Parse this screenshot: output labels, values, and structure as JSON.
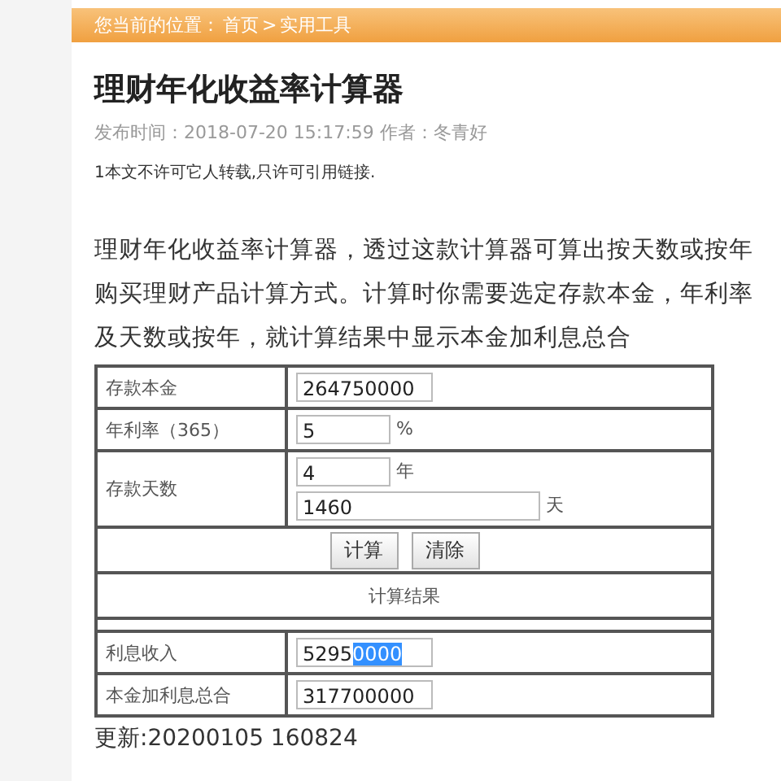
{
  "breadcrumb": {
    "label": "您当前的位置：",
    "links": [
      "首页",
      "实用工具"
    ],
    "separator": ">"
  },
  "article": {
    "title": "理财年化收益率计算器",
    "meta": "发布时间：2018-07-20 15:17:59 作者：冬青好",
    "notice": "1本文不许可它人转载,只许可引用链接.",
    "paragraph": "理财年化收益率计算器，透过这款计算器可算出按天数或按年购买理财产品计算方式。计算时你需要选定存款本金，年利率及天数或按年，就计算结果中显示本金加利息总合"
  },
  "calculator": {
    "principal": {
      "label": "存款本金",
      "value": "264750000"
    },
    "rate": {
      "label": "年利率（365）",
      "value": "5",
      "unit": "%"
    },
    "term": {
      "label": "存款天数",
      "years": "4",
      "years_unit": "年",
      "days": "1460",
      "days_unit": "天"
    },
    "buttons": [
      "计算",
      "清除"
    ],
    "result_heading": "计算结果",
    "interest": {
      "label": "利息收入",
      "value": "5295",
      "selected_text": "0000"
    },
    "total": {
      "label": "本金加利息总合",
      "value": "317700000"
    }
  },
  "updated": "更新:20200105 160824"
}
